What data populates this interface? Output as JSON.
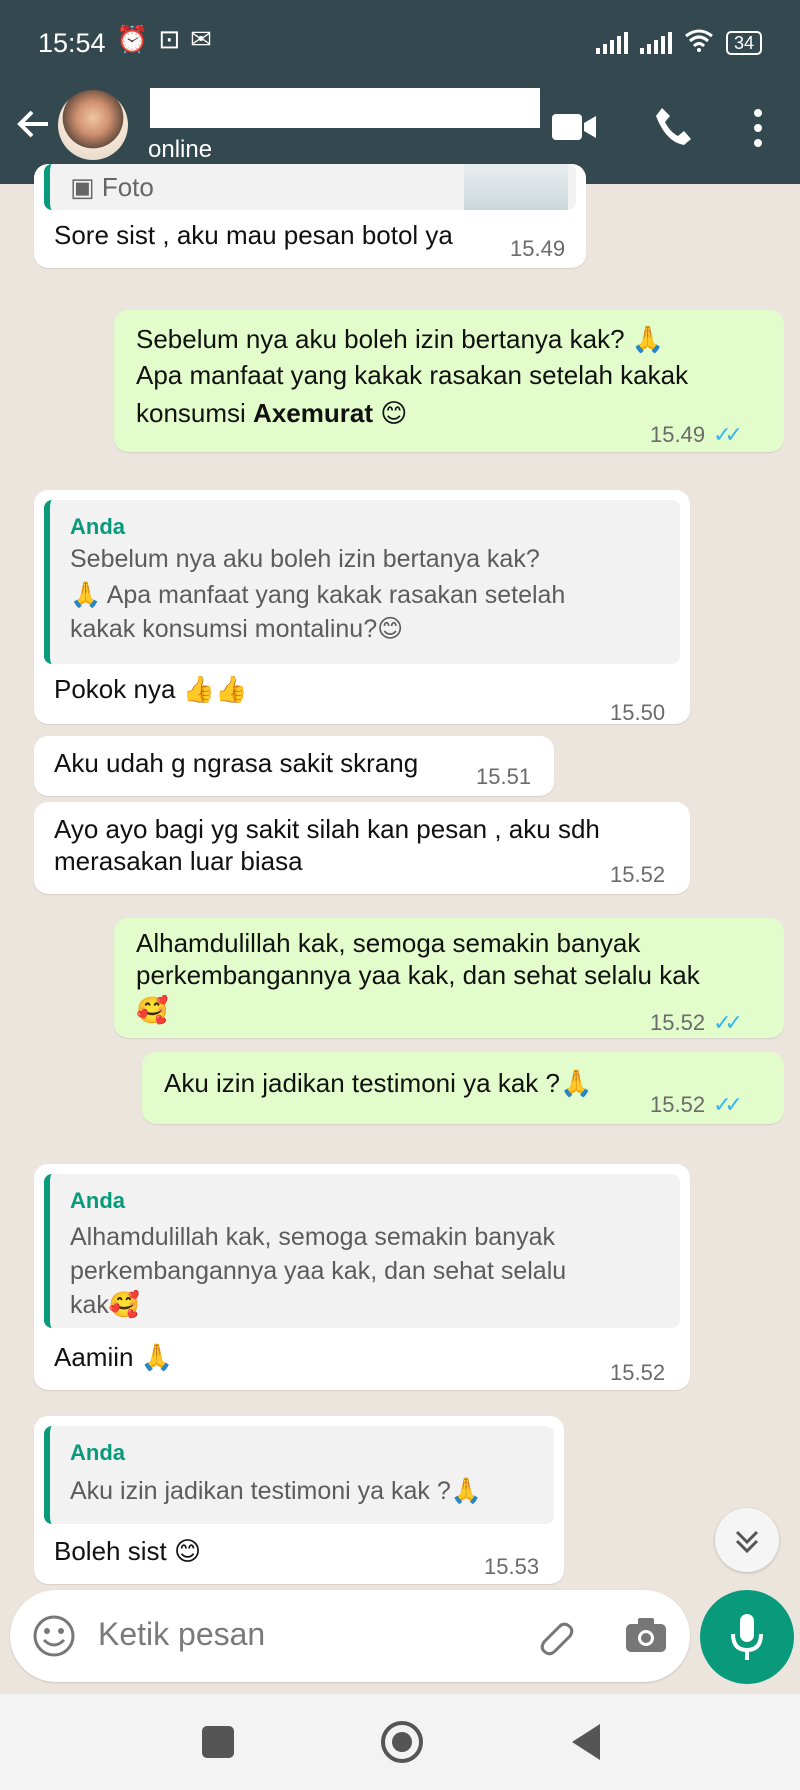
{
  "status_bar": {
    "time": "15:54",
    "battery": "34"
  },
  "header": {
    "status": "online"
  },
  "messages": [
    {
      "id": "m1",
      "dir": "in",
      "media_label": "Foto",
      "text": "Sore sist , aku mau pesan botol ya",
      "time": "15.49"
    },
    {
      "id": "m2",
      "dir": "out",
      "line1": "Sebelum nya aku boleh izin bertanya kak?",
      "line2": "Apa manfaat yang kakak rasakan setelah kakak",
      "line3_prefix": "konsumsi ",
      "line3_bold": "Axemurat",
      "time": "15.49"
    },
    {
      "id": "m3",
      "dir": "in",
      "quote_author": "Anda",
      "quote_line1": "Sebelum nya aku boleh izin bertanya kak?",
      "quote_line2": "Apa manfaat yang kakak rasakan setelah",
      "quote_line3": "kakak konsumsi montalinu?",
      "text": "Pokok nya",
      "time": "15.50"
    },
    {
      "id": "m4",
      "dir": "in",
      "text": "Aku udah g ngrasa sakit skrang",
      "time": "15.51"
    },
    {
      "id": "m5",
      "dir": "in",
      "line1": "Ayo ayo bagi yg sakit silah kan  pesan , aku sdh",
      "line2": "merasakan luar biasa",
      "time": "15.52"
    },
    {
      "id": "m6",
      "dir": "out",
      "line1": "Alhamdulillah kak, semoga semakin banyak",
      "line2": "perkembangannya yaa kak, dan sehat selalu kak",
      "time": "15.52"
    },
    {
      "id": "m7",
      "dir": "out",
      "text": "Aku izin jadikan testimoni ya kak ?",
      "time": "15.52"
    },
    {
      "id": "m8",
      "dir": "in",
      "quote_author": "Anda",
      "quote_line1": "Alhamdulillah kak, semoga semakin banyak",
      "quote_line2": "perkembangannya yaa kak, dan sehat selalu",
      "quote_line3": "kak",
      "text": "Aamiin",
      "time": "15.52"
    },
    {
      "id": "m9",
      "dir": "in",
      "quote_author": "Anda",
      "quote_line1": "Aku izin jadikan testimoni ya kak ?",
      "text": "Boleh sist",
      "time": "15.53"
    }
  ],
  "input": {
    "placeholder": "Ketik pesan"
  },
  "icons": {
    "back": "arrow-left-icon",
    "video": "video-call-icon",
    "phone": "phone-call-icon",
    "menu": "more-vert-icon",
    "emoji": "emoji-icon",
    "attach": "paperclip-icon",
    "camera": "camera-icon",
    "mic": "mic-icon",
    "scroll": "double-chevron-down-icon",
    "nav_recent": "square-icon",
    "nav_home": "circle-icon",
    "nav_back": "triangle-icon"
  },
  "colors": {
    "header": "#33494f",
    "chat_bg": "#ece5dd",
    "incoming": "#ffffff",
    "outgoing": "#e2fdcb",
    "accent": "#089a7a",
    "read_ticks": "#34b7f1"
  }
}
